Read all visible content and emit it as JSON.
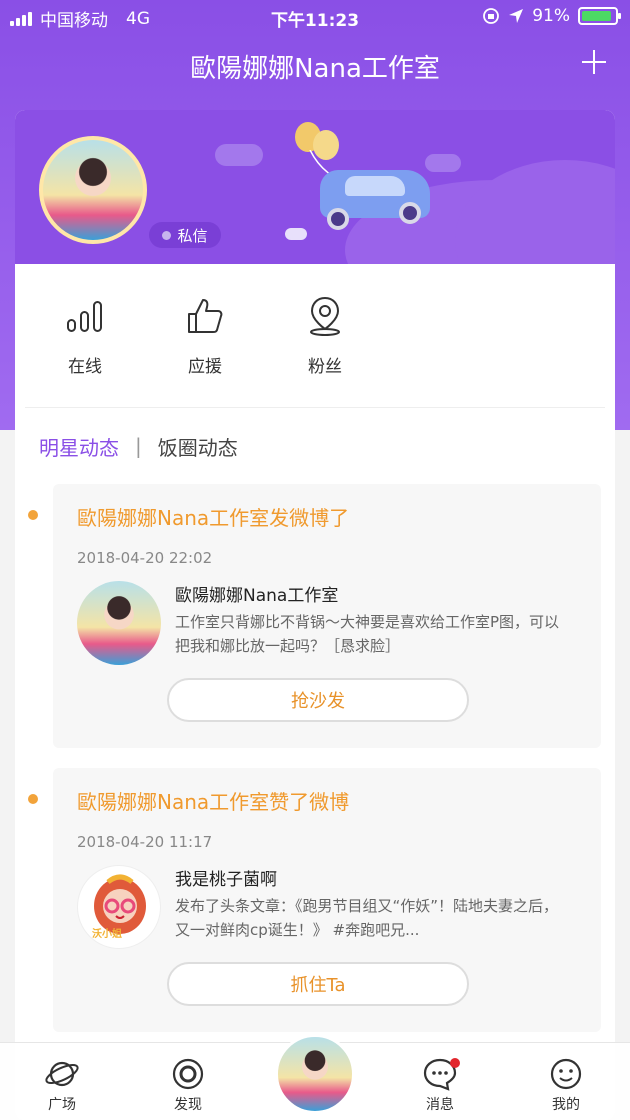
{
  "status_bar": {
    "carrier": "中国移动",
    "network": "4G",
    "time": "下午11:23",
    "battery_percent": "91%",
    "battery_level": 0.91
  },
  "nav": {
    "title": "歐陽娜娜Nana工作室",
    "action_icon": "plus-icon"
  },
  "profile": {
    "dm_label": "私信"
  },
  "stats": [
    {
      "icon": "signal-bars-icon",
      "label": "在线"
    },
    {
      "icon": "thumbs-up-icon",
      "label": "应援"
    },
    {
      "icon": "location-pin-icon",
      "label": "粉丝"
    }
  ],
  "tabs": {
    "active": "明星动态",
    "separator": "|",
    "inactive": "饭圈动态"
  },
  "feed": [
    {
      "title": "歐陽娜娜Nana工作室发微博了",
      "time": "2018-04-20 22:02",
      "author": "歐陽娜娜Nana工作室",
      "content": "工作室只背娜比不背锅～大神要是喜欢给工作室P图，可以把我和娜比放一起吗？［恳求脸］",
      "action": "抢沙发"
    },
    {
      "title": "歐陽娜娜Nana工作室赞了微博",
      "time": "2018-04-20 11:17",
      "author": "我是桃子菌啊",
      "content": "发布了头条文章：《跑男节目组又“作妖”！陆地夫妻之后，又一对鲜肉cp诞生！》 #奔跑吧兄...",
      "action": "抓住Ta",
      "avatar_label": "沃小姐"
    }
  ],
  "tabbar": {
    "items": [
      {
        "icon": "planet-icon",
        "label": "广场"
      },
      {
        "icon": "discover-icon",
        "label": "发现"
      },
      {
        "icon": "message-icon",
        "label": "消息"
      },
      {
        "icon": "profile-face-icon",
        "label": "我的"
      }
    ]
  },
  "colors": {
    "accent": "#8a4fe6",
    "feed_title": "#f09a2e",
    "battery": "#4cd964"
  }
}
